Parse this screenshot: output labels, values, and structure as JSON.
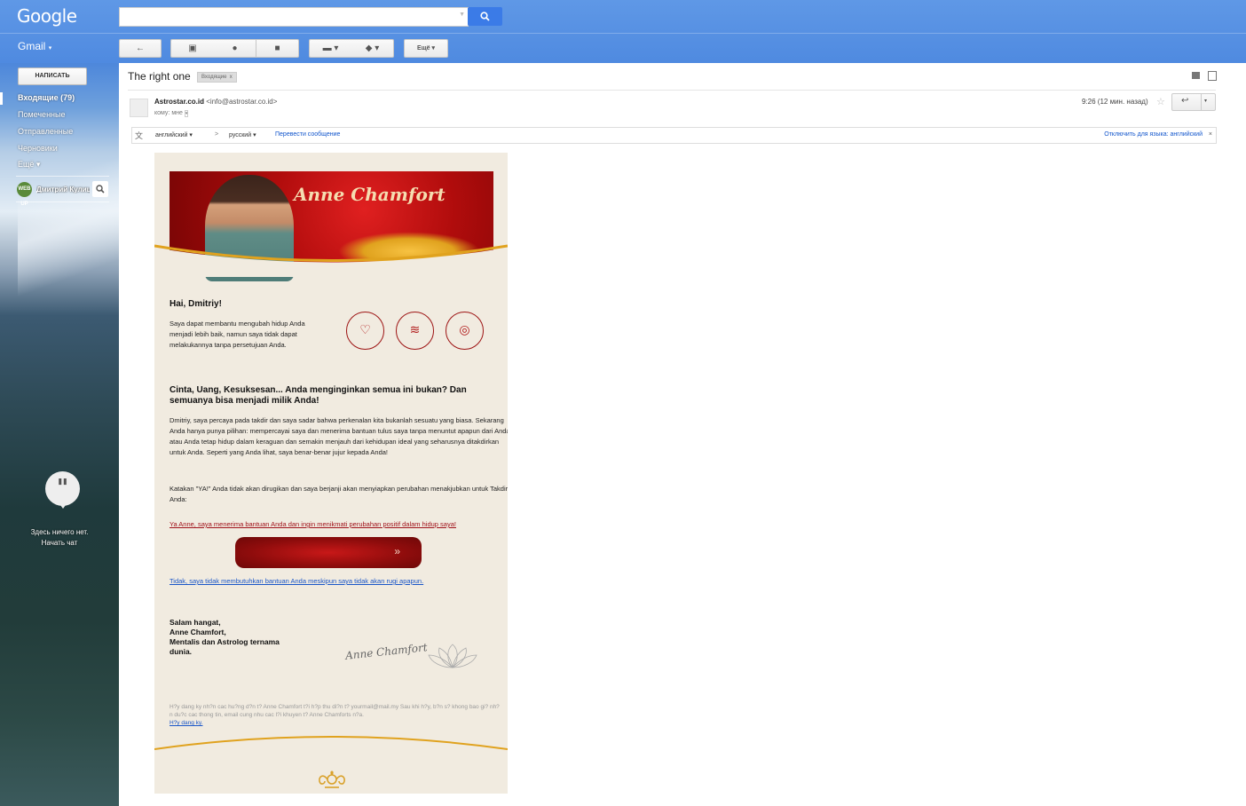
{
  "header": {
    "logo": "Google",
    "app_name": "Gmail",
    "toolbar": {
      "more_label": "Ещё"
    }
  },
  "sidebar": {
    "compose_label": "НАПИСАТЬ",
    "items": [
      {
        "label": "Входящие (79)",
        "active": true
      },
      {
        "label": "Помеченные",
        "active": false
      },
      {
        "label": "Отправленные",
        "active": false
      },
      {
        "label": "Черновики",
        "active": false
      },
      {
        "label": "Ещё",
        "active": false
      }
    ],
    "user_name": "Дмитрий Кулиц",
    "user_initials": "WEB UP",
    "chat_empty_line1": "Здесь ничего нет.",
    "chat_empty_line2": "Начать чат"
  },
  "message": {
    "subject": "The right one",
    "label_chip": "Входящие",
    "label_chip_close": "x",
    "sender_name": "Astrostar.co.id",
    "sender_email": "<info@astrostar.co.id>",
    "to_me": "кому: мне",
    "time": "9:26 (12 мин. назад)"
  },
  "translate_bar": {
    "from_lang": "английский",
    "to_lang": "русский",
    "arrow": ">",
    "translate_link": "Перевести сообщение",
    "disable_link": "Отключить для языка: английский"
  },
  "email": {
    "banner_title": "Anne Chamfort",
    "greeting": "Hai, Dmitriy!",
    "intro": "Saya dapat membantu mengubah hidup Anda menjadi lebih baik, namun saya tidak dapat melakukannya tanpa persetujuan Anda.",
    "heading": "Cinta, Uang, Kesuksesan... Anda menginginkan semua ini bukan? Dan semuanya bisa menjadi milik Anda!",
    "para1": "Dmitriy, saya percaya pada takdir dan saya sadar bahwa perkenalan kita bukanlah sesuatu yang biasa. Sekarang Anda hanya punya pilihan: mempercayai saya dan menerima bantuan tulus saya tanpa menuntut apapun dari Anda atau Anda tetap hidup dalam keraguan dan semakin menjauh dari kehidupan ideal yang seharusnya ditakdirkan untuk Anda. Seperti yang Anda lihat, saya benar-benar jujur kepada Anda!",
    "para2": "Katakan \"YA!\" Anda tidak akan dirugikan dan saya berjanji akan menyiapkan perubahan menakjubkan untuk Takdir Anda:",
    "yes_link": "Ya Anne, saya menerima bantuan Anda dan ingin menikmati perubahan positif dalam hidup saya!",
    "cta_arrow": "»",
    "no_link": "Tidak, saya tidak membutuhkan bantuan Anda meskipun saya tidak akan rugi apapun.",
    "sign_line1": "Salam hangat,",
    "sign_line2": "Anne Chamfort,",
    "sign_line3": "Mentalis dan Astrolog ternama",
    "sign_line4": "dunia.",
    "signature": "Anne Chamfort",
    "footer_text": "H?y dang ky nh?n cac hu?ng d?n t? Anne Chamfort t?i h?p thu di?n t? yourmail@mail.my Sau khi h?y, b?n s? khong bao gi? nh?n du?c cac thong tin, email cung nhu cac l?i khuyen t? Anne Chamforts n?a.",
    "footer_link": "H?y dang ky."
  },
  "colors": {
    "topbar": "#4f8ae0",
    "search_button": "#3b7be7",
    "email_bg": "#f1ebe0",
    "brand_red": "#b01818",
    "link_blue": "#1155cc"
  }
}
